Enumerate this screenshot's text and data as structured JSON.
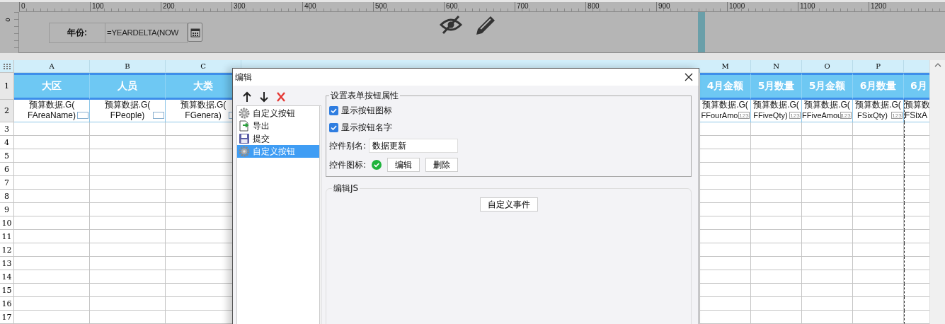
{
  "ruler": {
    "ticks": [
      "0",
      "100",
      "200",
      "300",
      "400",
      "500",
      "600",
      "700",
      "800",
      "900",
      "1000",
      "1100",
      "1200"
    ],
    "vertical_tick": "0"
  },
  "form": {
    "year_label": "年份:",
    "year_formula": "=YEARDELTA(NOW"
  },
  "sheet": {
    "row_numbers": [
      "1",
      "2",
      "3",
      "4",
      "5",
      "6",
      "7",
      "8",
      "9",
      "10",
      "11",
      "12",
      "13",
      "14",
      "15",
      "16",
      "17"
    ],
    "columns": [
      {
        "letter": "A",
        "header": "大区",
        "formula": "预算数据.G(",
        "field": "FAreaName)",
        "kind": "text"
      },
      {
        "letter": "B",
        "header": "人员",
        "formula": "预算数据.G(",
        "field": "FPeople)",
        "kind": "text"
      },
      {
        "letter": "C",
        "header": "大类",
        "formula": "预算数据.G(",
        "field": "FGenera)",
        "kind": "text"
      },
      {
        "letter": "M",
        "header": "4月金额",
        "formula": "预算数据.G(",
        "field": "FFourAmo",
        "kind": "number",
        "type_badge": "123"
      },
      {
        "letter": "N",
        "header": "5月数量",
        "formula": "预算数据.G(",
        "field": "FFiveQty)",
        "kind": "number",
        "type_badge": "123"
      },
      {
        "letter": "O",
        "header": "5月金额",
        "formula": "预算数据.G(",
        "field": "FFiveAmou",
        "kind": "number",
        "type_badge": "123"
      },
      {
        "letter": "P",
        "header": "6月数量",
        "formula": "预算数据.G(",
        "field": "FSixQty)",
        "kind": "number",
        "type_badge": "123"
      },
      {
        "header": "6月",
        "formula": "预算数",
        "field": "FSixA"
      }
    ]
  },
  "dialog": {
    "title": "编辑",
    "items": [
      {
        "label": "自定义按钮",
        "kind": "gear",
        "selected": false
      },
      {
        "label": "导出",
        "kind": "export",
        "selected": false
      },
      {
        "label": "提交",
        "kind": "save",
        "selected": false
      },
      {
        "label": "自定义按钮",
        "kind": "gear",
        "selected": true
      }
    ],
    "group_title": "设置表单按钮属性",
    "checkboxes": [
      {
        "label": "显示按钮图标",
        "checked": true
      },
      {
        "label": "显示按钮名字",
        "checked": true
      }
    ],
    "alias_label": "控件别名:",
    "alias_value": "数据更新",
    "icon_label": "控件图标:",
    "icon_buttons": [
      "编辑",
      "删除"
    ],
    "js_title": "编辑JS",
    "js_button": "自定义事件"
  }
}
